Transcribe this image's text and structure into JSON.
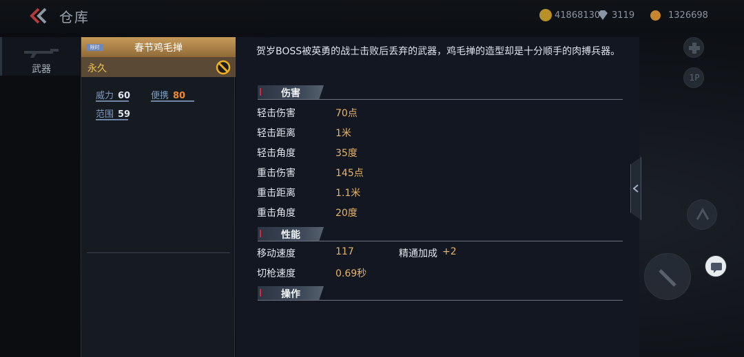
{
  "header": {
    "title": "仓库",
    "currencies": [
      {
        "icon": "gold-coin-icon",
        "value": "41868130",
        "color": "#b8902a"
      },
      {
        "icon": "diamond-icon",
        "value": "3119",
        "color": "#8a96a6"
      },
      {
        "icon": "token-icon",
        "value": "1326698",
        "color": "#c7862e"
      }
    ]
  },
  "sidebar": {
    "active_label": "武器"
  },
  "item": {
    "name": "春节鸡毛掸",
    "tag": "限时",
    "duration": "永久",
    "stats": [
      {
        "label": "威力",
        "value": "60",
        "fill": 0.6,
        "color": "#dfe6ee"
      },
      {
        "label": "便携",
        "value": "80",
        "fill": 0.8,
        "color": "#f08a2c"
      },
      {
        "label": "范围",
        "value": "59",
        "fill": 0.59,
        "color": "#dfe6ee"
      }
    ]
  },
  "detail": {
    "description": "贺岁BOSS被英勇的战士击败后丢弃的武器，鸡毛掸的造型却是十分顺手的肉搏兵器。",
    "sections": {
      "damage": {
        "title": "伤害",
        "rows": [
          {
            "label": "轻击伤害",
            "value": "70点"
          },
          {
            "label": "轻击距离",
            "value": "1米"
          },
          {
            "label": "轻击角度",
            "value": "35度"
          },
          {
            "label": "重击伤害",
            "value": "145点"
          },
          {
            "label": "重击距离",
            "value": "1.1米"
          },
          {
            "label": "重击角度",
            "value": "20度"
          }
        ]
      },
      "performance": {
        "title": "性能",
        "rows": [
          {
            "label": "移动速度",
            "value": "117"
          },
          {
            "label": "切枪速度",
            "value": "0.69秒"
          }
        ],
        "bonus_label": "精通加成",
        "bonus_value": "+2"
      },
      "controls": {
        "title": "操作"
      }
    }
  },
  "overlay": {
    "player_label": "1P"
  }
}
